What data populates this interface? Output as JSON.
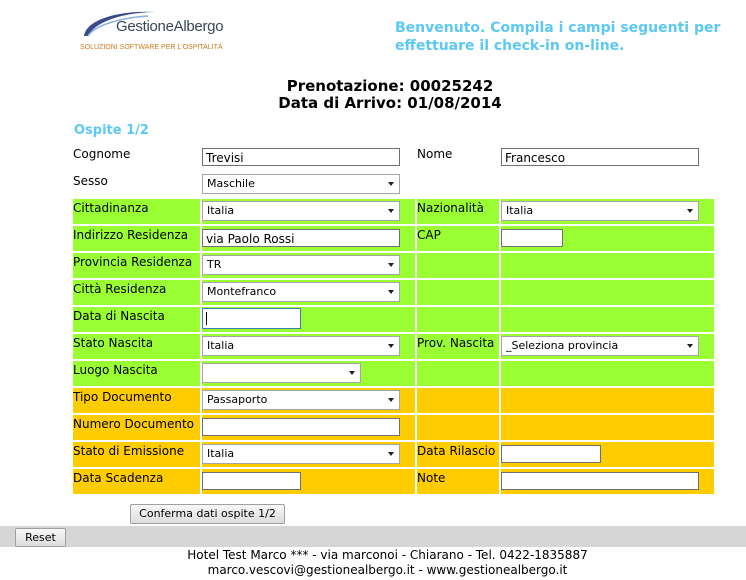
{
  "header": {
    "logo_name": "GestioneAlbergo",
    "logo_tagline": "SOLUZIONI SOFTWARE PER L'OSPITALITÀ",
    "welcome_line1": "Benvenuto. Compila i campi seguenti per",
    "welcome_line2": "effettuare il check-in on-line."
  },
  "booking": {
    "reservation": "Prenotazione: 00025242",
    "arrival": "Data di Arrivo: 01/08/2014"
  },
  "guest_title": "Ospite 1/2",
  "form": {
    "cognome_label": "Cognome",
    "cognome_value": "Trevisi",
    "nome_label": "Nome",
    "nome_value": "Francesco",
    "sesso_label": "Sesso",
    "sesso_value": "Maschile",
    "cittadinanza_label": "Cittadinanza",
    "cittadinanza_value": "Italia",
    "nazionalita_label": "Nazionalità",
    "nazionalita_value": "Italia",
    "indirizzo_label": "Indirizzo Residenza",
    "indirizzo_value": "via Paolo Rossi",
    "cap_label": "CAP",
    "cap_value": "",
    "provincia_label": "Provincia Residenza",
    "provincia_value": "TR",
    "citta_label": "Città Residenza",
    "citta_value": "Montefranco",
    "data_nascita_label": "Data di Nascita",
    "data_nascita_value": "",
    "stato_nascita_label": "Stato Nascita",
    "stato_nascita_value": "Italia",
    "prov_nascita_label": "Prov. Nascita",
    "prov_nascita_value": "_Seleziona provincia",
    "luogo_nascita_label": "Luogo Nascita",
    "luogo_nascita_value": "",
    "tipo_doc_label": "Tipo Documento",
    "tipo_doc_value": "Passaporto",
    "numero_doc_label": "Numero Documento",
    "numero_doc_value": "",
    "stato_emissione_label": "Stato di Emissione",
    "stato_emissione_value": "Italia",
    "data_rilascio_label": "Data Rilascio",
    "data_rilascio_value": "",
    "data_scadenza_label": "Data Scadenza",
    "data_scadenza_value": "",
    "note_label": "Note",
    "note_value": ""
  },
  "buttons": {
    "confirm": "Conferma dati ospite 1/2",
    "reset": "Reset"
  },
  "footer": {
    "line1": "Hotel Test Marco *** - via marconoi - Chiarano - Tel. 0422-1835887",
    "line2": "marco.vescovi@gestionealbergo.it - www.gestionealbergo.it"
  },
  "colors": {
    "accent": "#5bc8f5",
    "green_section": "#99ff33",
    "orange_section": "#ffcc00",
    "footer_bar": "#d6d6d6"
  }
}
